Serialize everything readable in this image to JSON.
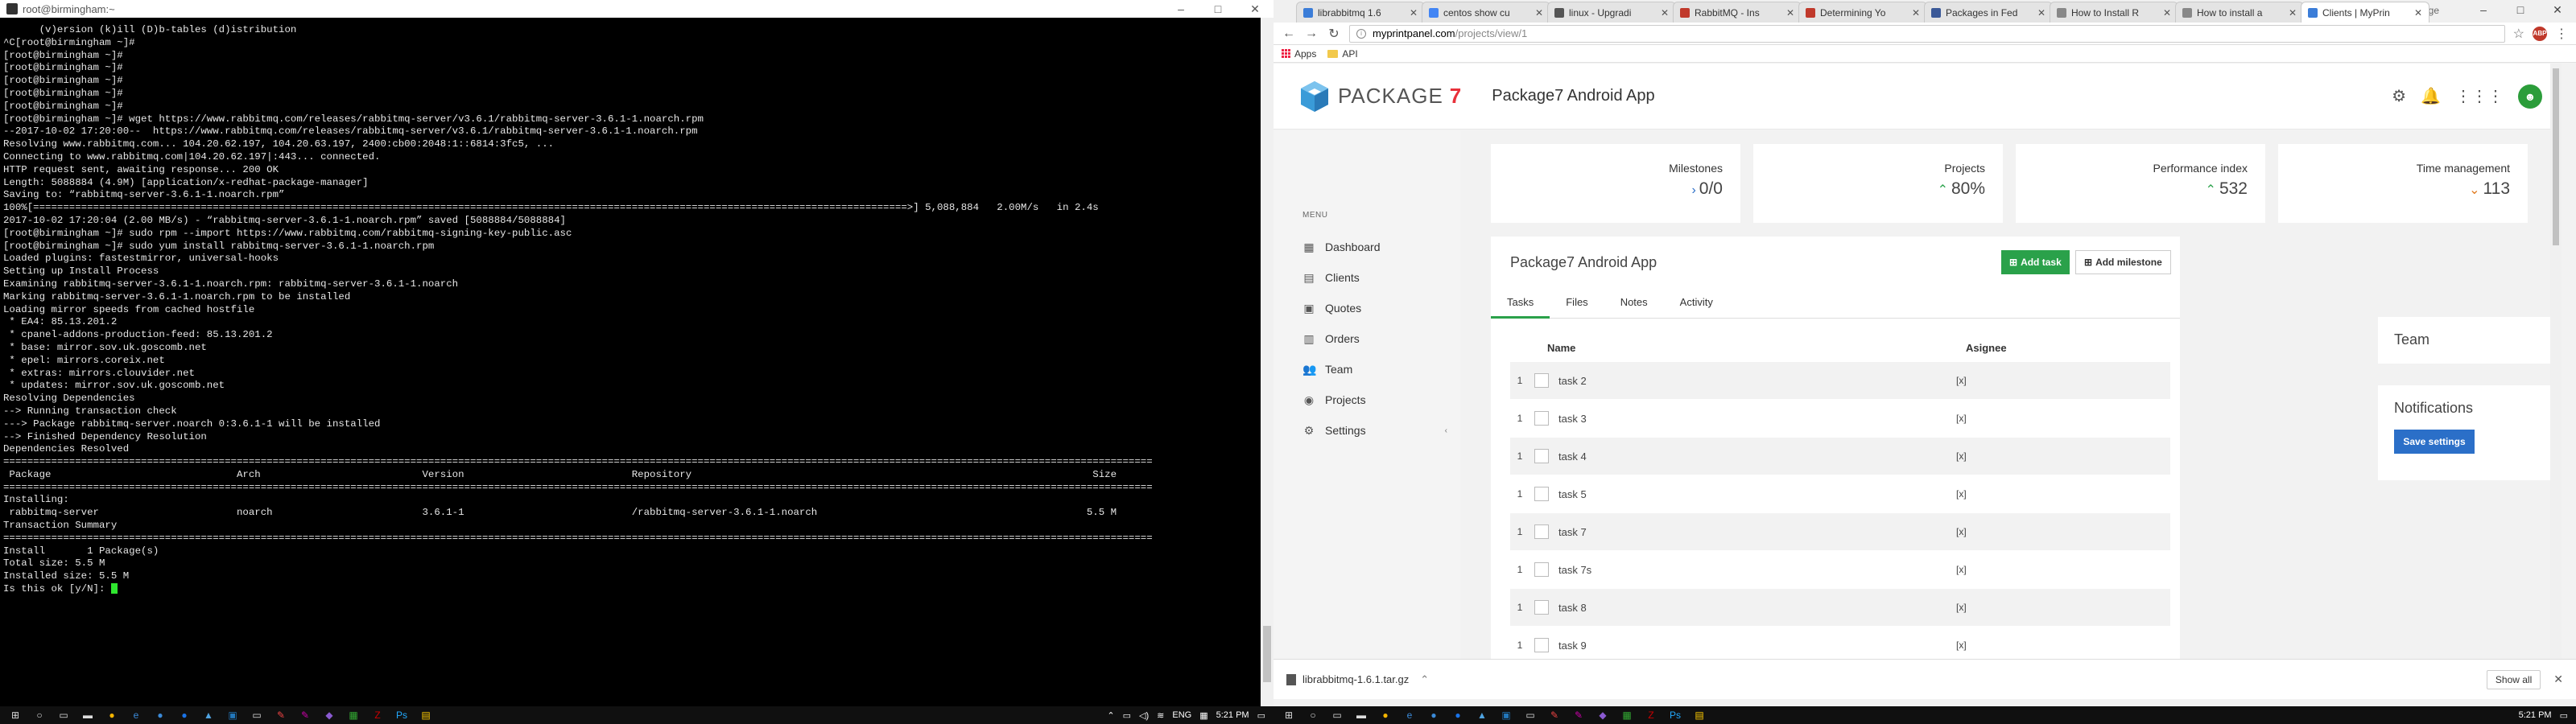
{
  "terminal": {
    "title": "root@birmingham:~",
    "controls": [
      "–",
      "□",
      "✕"
    ],
    "lines": [
      "      (v)ersion (k)ill (D)b-tables (d)istribution",
      "^C[root@birmingham ~]#",
      "[root@birmingham ~]#",
      "[root@birmingham ~]#",
      "[root@birmingham ~]#",
      "[root@birmingham ~]#",
      "[root@birmingham ~]#",
      "[root@birmingham ~]# wget https://www.rabbitmq.com/releases/rabbitmq-server/v3.6.1/rabbitmq-server-3.6.1-1.noarch.rpm",
      "--2017-10-02 17:20:00--  https://www.rabbitmq.com/releases/rabbitmq-server/v3.6.1/rabbitmq-server-3.6.1-1.noarch.rpm",
      "Resolving www.rabbitmq.com... 104.20.62.197, 104.20.63.197, 2400:cb00:2048:1::6814:3fc5, ...",
      "Connecting to www.rabbitmq.com|104.20.62.197|:443... connected.",
      "HTTP request sent, awaiting response... 200 OK",
      "Length: 5088884 (4.9M) [application/x-redhat-package-manager]",
      "Saving to: “rabbitmq-server-3.6.1-1.noarch.rpm”",
      "",
      "100%[==================================================================================================================================================>] 5,088,884   2.00M/s   in 2.4s",
      "",
      "2017-10-02 17:20:04 (2.00 MB/s) - “rabbitmq-server-3.6.1-1.noarch.rpm” saved [5088884/5088884]",
      "",
      "[root@birmingham ~]# sudo rpm --import https://www.rabbitmq.com/rabbitmq-signing-key-public.asc",
      "[root@birmingham ~]# sudo yum install rabbitmq-server-3.6.1-1.noarch.rpm",
      "Loaded plugins: fastestmirror, universal-hooks",
      "Setting up Install Process",
      "Examining rabbitmq-server-3.6.1-1.noarch.rpm: rabbitmq-server-3.6.1-1.noarch",
      "Marking rabbitmq-server-3.6.1-1.noarch.rpm to be installed",
      "Loading mirror speeds from cached hostfile",
      " * EA4: 85.13.201.2",
      " * cpanel-addons-production-feed: 85.13.201.2",
      " * base: mirror.sov.uk.goscomb.net",
      " * epel: mirrors.coreix.net",
      " * extras: mirrors.clouvider.net",
      " * updates: mirror.sov.uk.goscomb.net",
      "Resolving Dependencies",
      "--> Running transaction check",
      "---> Package rabbitmq-server.noarch 0:3.6.1-1 will be installed",
      "--> Finished Dependency Resolution",
      "",
      "Dependencies Resolved",
      "",
      "================================================================================================================================================================================================",
      " Package                               Arch                           Version                            Repository                                                                   Size",
      "================================================================================================================================================================================================",
      "Installing:",
      " rabbitmq-server                       noarch                         3.6.1-1                            /rabbitmq-server-3.6.1-1.noarch                                             5.5 M",
      "",
      "Transaction Summary",
      "================================================================================================================================================================================================",
      "Install       1 Package(s)",
      "",
      "Total size: 5.5 M",
      "Installed size: 5.5 M",
      "Is this ok [y/N]: "
    ]
  },
  "taskbar": {
    "left_time": "5:21 PM",
    "left_lang": "ENG",
    "right_time": "5:21 PM"
  },
  "browser": {
    "tabs": [
      {
        "label": "librabbitmq 1.6",
        "color": "#3b7dd8"
      },
      {
        "label": "centos show cu",
        "color": "#4285f4"
      },
      {
        "label": "linux - Upgradi",
        "color": "#555555"
      },
      {
        "label": "RabbitMQ - Ins",
        "color": "#c0392b"
      },
      {
        "label": "Determining Yo",
        "color": "#c0392b"
      },
      {
        "label": "Packages in Fed",
        "color": "#3b5998"
      },
      {
        "label": "How to Install R",
        "color": "#888888"
      },
      {
        "label": "How to install a",
        "color": "#888888"
      },
      {
        "label": "Clients | MyPrin",
        "color": "#3b7dd8",
        "active": true
      }
    ],
    "user_label": "Ghyrge",
    "window_controls": [
      "–",
      "□",
      "✕"
    ],
    "url_host": "myprintpanel.com",
    "url_path": "/projects/view/1",
    "bookmarks": [
      {
        "label": "Apps"
      },
      {
        "label": "API"
      }
    ],
    "download_file": "librabbitmq-1.6.1.tar.gz",
    "show_all": "Show all"
  },
  "app": {
    "logo_word": "PACKAGE",
    "logo_number": "7",
    "project_title": "Package7 Android App",
    "menu_title": "MENU",
    "sidebar": [
      {
        "label": "Dashboard",
        "icon": "▦"
      },
      {
        "label": "Clients",
        "icon": "▤"
      },
      {
        "label": "Quotes",
        "icon": "▣"
      },
      {
        "label": "Orders",
        "icon": "▥"
      },
      {
        "label": "Team",
        "icon": "👥"
      },
      {
        "label": "Projects",
        "icon": "◉"
      },
      {
        "label": "Settings",
        "icon": "⚙"
      }
    ],
    "stats": [
      {
        "label": "Milestones",
        "value": "0/0",
        "arrow": "›",
        "arrow_color": "blue"
      },
      {
        "label": "Projects",
        "value": "80%",
        "arrow": "⌃",
        "arrow_color": "green"
      },
      {
        "label": "Performance index",
        "value": "532",
        "arrow": "⌃",
        "arrow_color": "green"
      },
      {
        "label": "Time management",
        "value": "113",
        "arrow": "⌄",
        "arrow_color": "orange"
      }
    ],
    "card_title": "Package7 Android App",
    "add_task": "Add task",
    "add_milestone": "Add milestone",
    "card_tabs": [
      "Tasks",
      "Files",
      "Notes",
      "Activity"
    ],
    "table_headers": {
      "name": "Name",
      "assignee": "Asignee"
    },
    "tasks": [
      {
        "num": "1",
        "name": "task 2",
        "assignee": "[x]"
      },
      {
        "num": "1",
        "name": "task 3",
        "assignee": "[x]"
      },
      {
        "num": "1",
        "name": "task 4",
        "assignee": "[x]"
      },
      {
        "num": "1",
        "name": "task 5",
        "assignee": "[x]"
      },
      {
        "num": "1",
        "name": "task 7",
        "assignee": "[x]"
      },
      {
        "num": "1",
        "name": "task 7s",
        "assignee": "[x]"
      },
      {
        "num": "1",
        "name": "task 8",
        "assignee": "[x]"
      },
      {
        "num": "1",
        "name": "task 9",
        "assignee": "[x]"
      }
    ],
    "team_title": "Team",
    "notifications_title": "Notifications",
    "save_settings": "Save settings"
  }
}
